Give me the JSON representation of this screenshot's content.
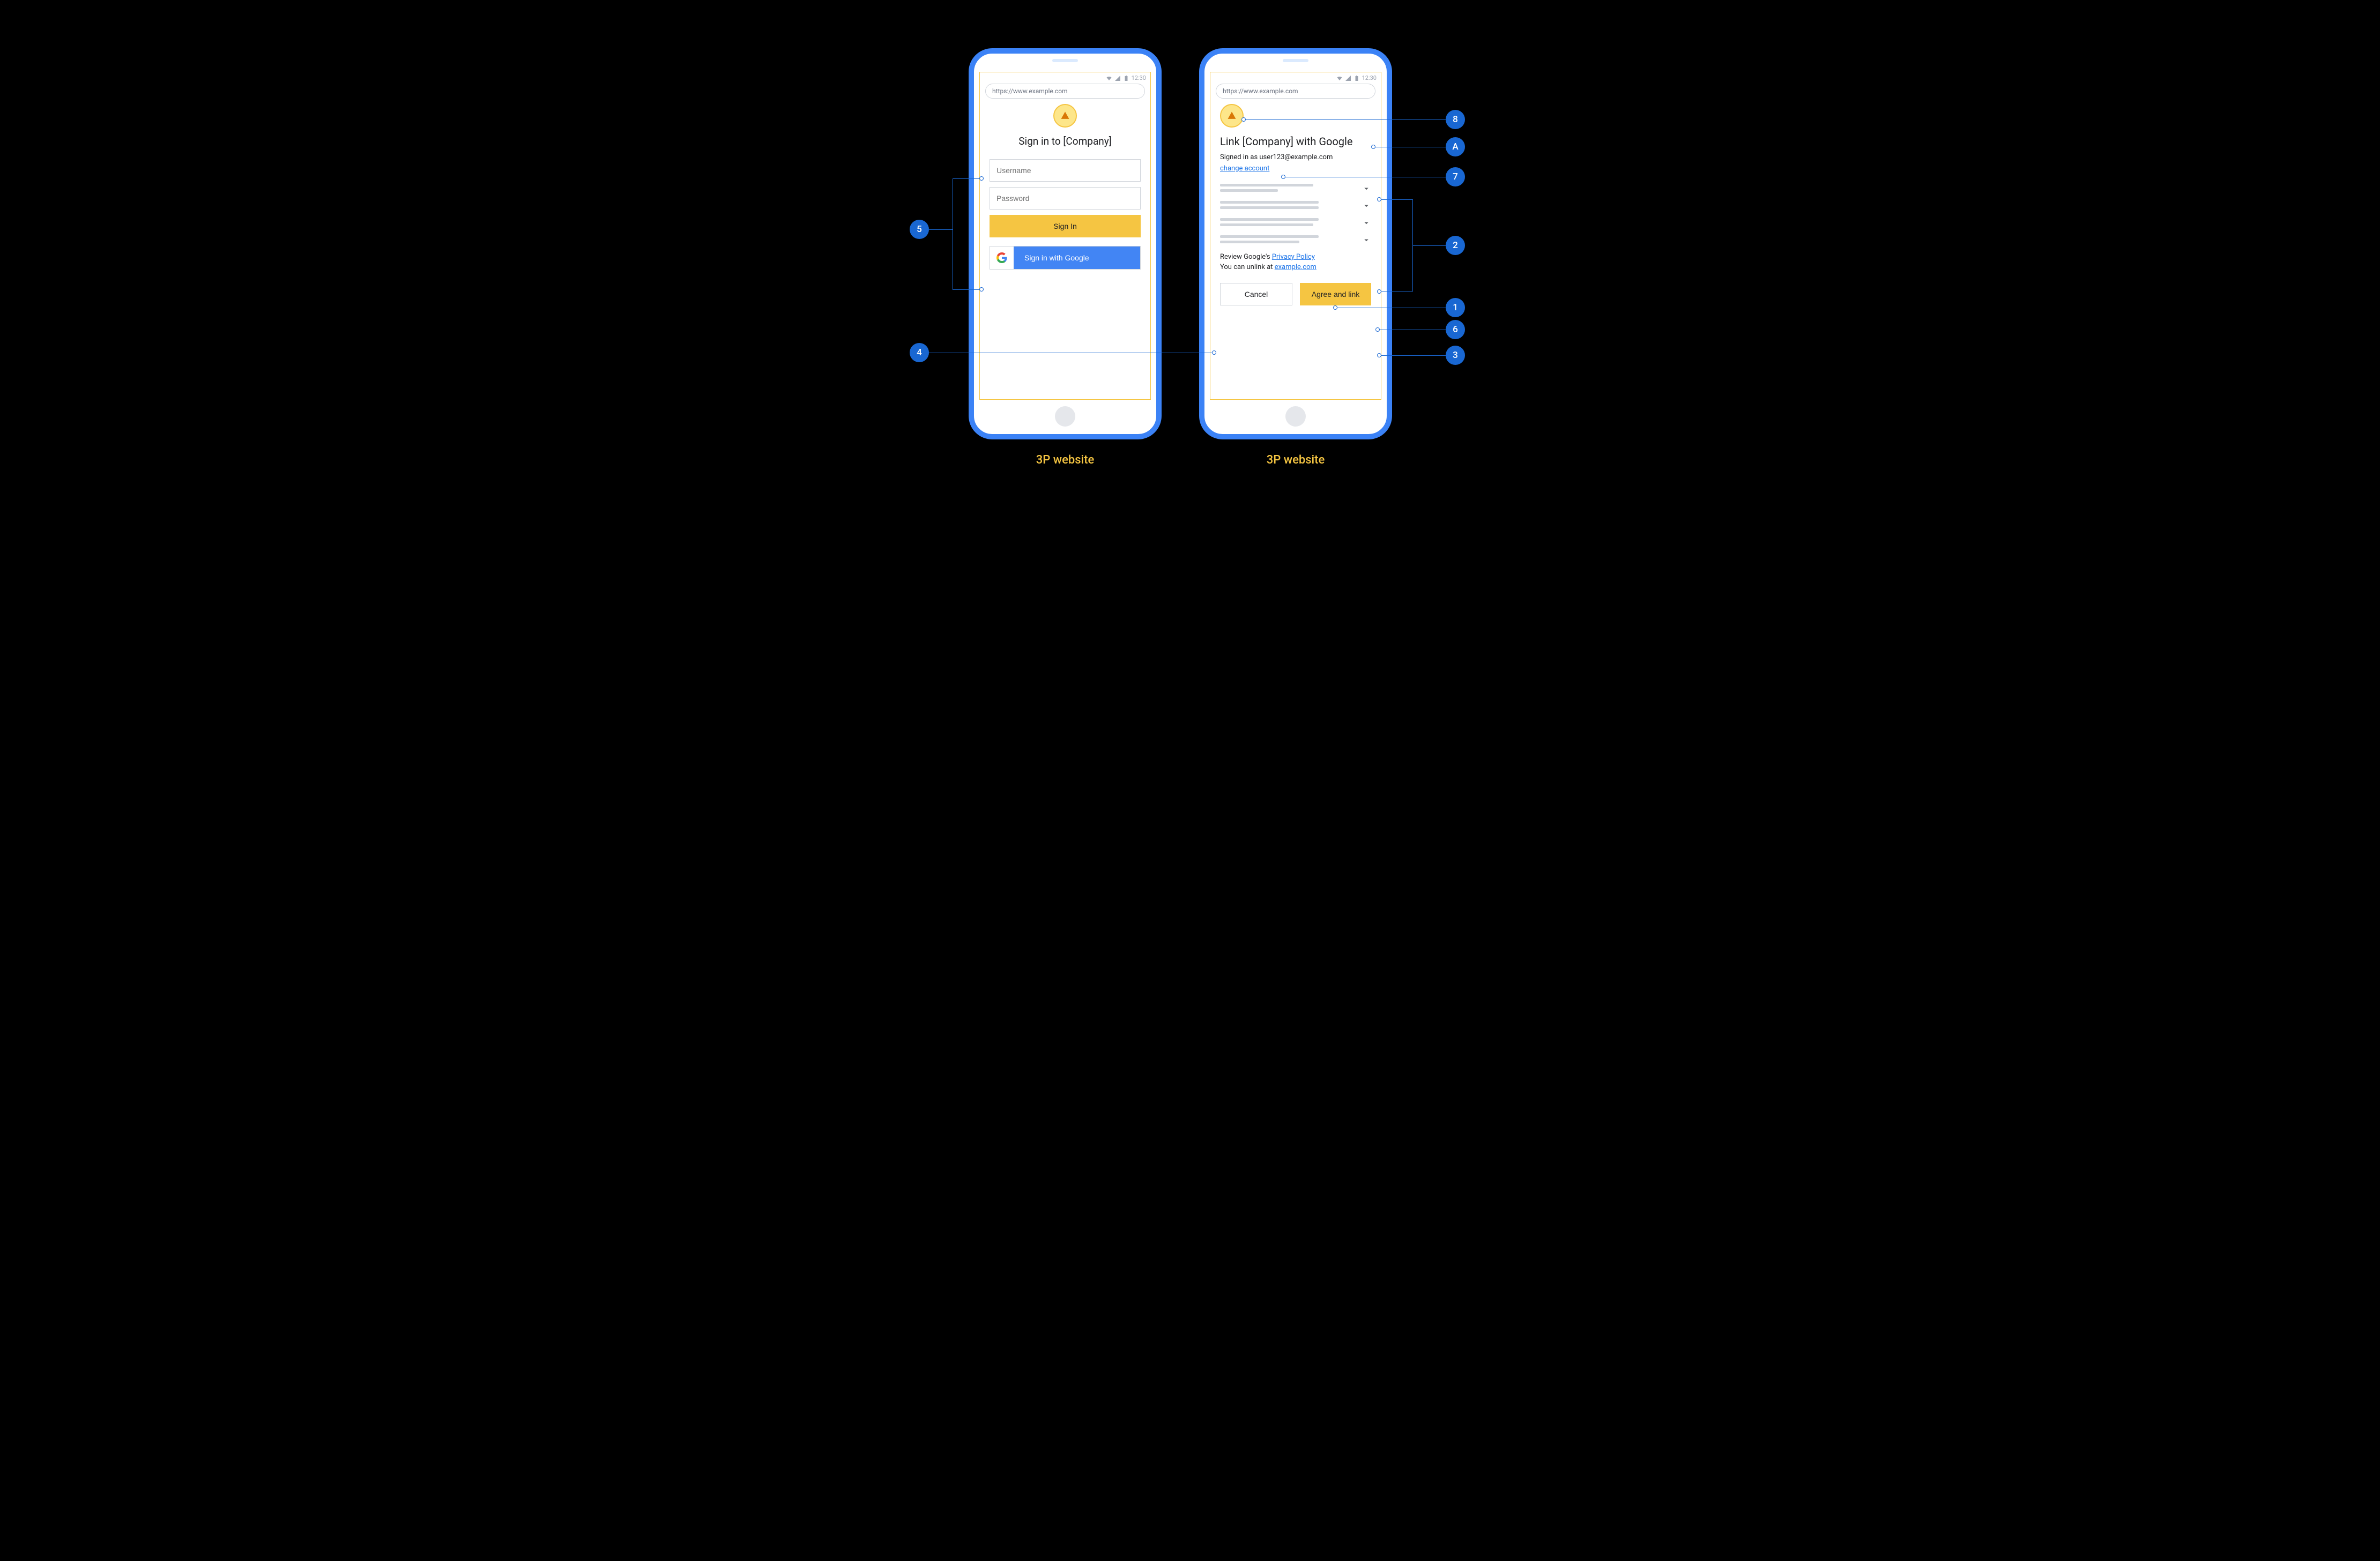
{
  "status": {
    "time": "12:30"
  },
  "url_bar": "https://www.example.com",
  "screen1": {
    "heading": "Sign in to [Company]",
    "username_placeholder": "Username",
    "password_placeholder": "Password",
    "signin_label": "Sign In",
    "google_label": "Sign in with Google"
  },
  "screen2": {
    "heading": "Link [Company] with Google",
    "signed_in_as": "Signed in as user123@example.com",
    "change_account": "change account",
    "review_prefix": "Review Google's ",
    "privacy_policy": "Privacy Policy",
    "unlink_prefix": "You can unlink at ",
    "unlink_link": "example.com",
    "cancel_label": "Cancel",
    "agree_label": "Agree and link"
  },
  "captions": {
    "left": "3P website",
    "right": "3P website"
  },
  "annotations": {
    "a5": "5",
    "a4": "4",
    "a8": "8",
    "aA": "A",
    "a7": "7",
    "a2": "2",
    "a1": "1",
    "a6": "6",
    "a3": "3"
  }
}
